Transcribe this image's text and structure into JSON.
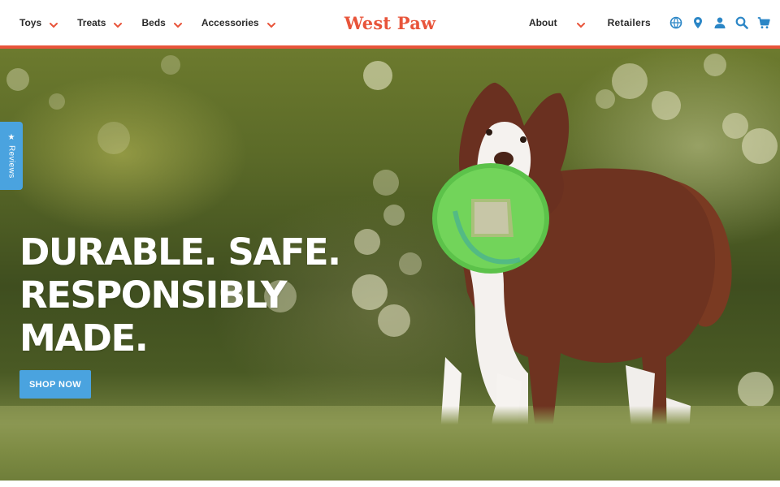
{
  "brand": {
    "logo_text": "West Paw",
    "accent_color": "#e8543a",
    "cta_color": "#4aa3df"
  },
  "nav_left": [
    {
      "label": "Toys"
    },
    {
      "label": "Treats"
    },
    {
      "label": "Beds"
    },
    {
      "label": "Accessories"
    }
  ],
  "nav_right": {
    "about_label": "About",
    "retailers_label": "Retailers",
    "icons": [
      "globe-icon",
      "location-pin-icon",
      "account-icon",
      "search-icon",
      "cart-icon"
    ]
  },
  "reviews_tab": {
    "label": "Reviews",
    "icon": "star-icon"
  },
  "hero": {
    "headline_lines": [
      "Durable. Safe.",
      "Responsibly",
      "Made."
    ],
    "cta_label": "Shop Now",
    "image_subject": "dog-with-frisbee"
  }
}
